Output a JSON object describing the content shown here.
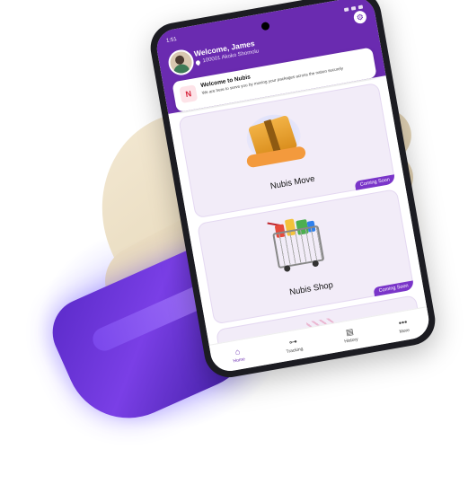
{
  "statusbar": {
    "time": "1:51"
  },
  "header": {
    "welcome": "Welcome, James",
    "location": "100001 Akoko Shomolu"
  },
  "banner": {
    "title": "Welcome to Nubis",
    "text": "We are here to serve you by moving your packages across the nation securely"
  },
  "cards": [
    {
      "title": "Nubis Move",
      "badge": "Coming Soon"
    },
    {
      "title": "Nubis Shop",
      "badge": "Coming Soon"
    }
  ],
  "tabs": [
    {
      "label": "Home",
      "icon": "home-icon"
    },
    {
      "label": "Tracking",
      "icon": "tracking-icon"
    },
    {
      "label": "History",
      "icon": "history-icon"
    },
    {
      "label": "More",
      "icon": "more-icon"
    }
  ],
  "colors": {
    "brand": "#6a2bb0",
    "badge": "#7a35c9",
    "sleeve": "#5a2ac8"
  }
}
